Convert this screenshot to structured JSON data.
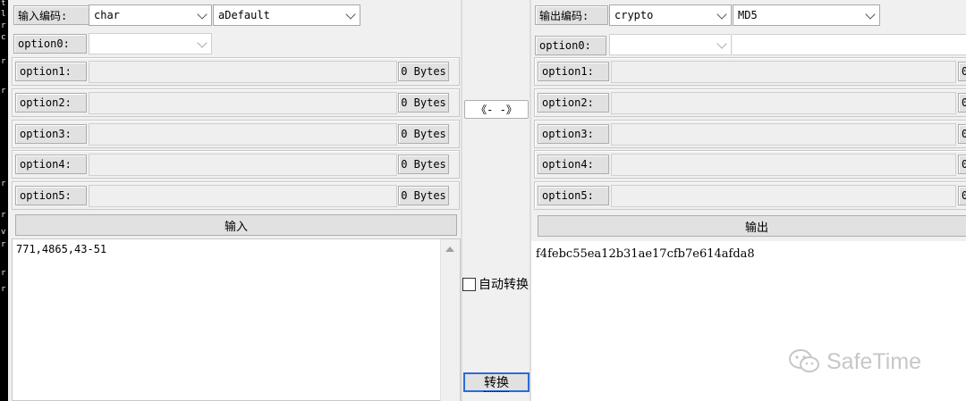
{
  "left_strip_chars": [
    "t",
    "l",
    "r",
    "c",
    "r",
    "r",
    "r",
    "r",
    "v",
    "r",
    "r",
    "r"
  ],
  "input_panel": {
    "encoding_label": "输入编码:",
    "encoding_value": "char",
    "variant_value": "aDefault",
    "option0_label": "option0:",
    "option0_value": "",
    "options": [
      {
        "label": "option1:",
        "size": "0 Bytes"
      },
      {
        "label": "option2:",
        "size": "0 Bytes"
      },
      {
        "label": "option3:",
        "size": "0 Bytes"
      },
      {
        "label": "option4:",
        "size": "0 Bytes"
      },
      {
        "label": "option5:",
        "size": "0 Bytes"
      }
    ],
    "section_button": "输入",
    "text": "771,4865,43-51"
  },
  "middle": {
    "swap_label": "《- -》",
    "auto_convert_label": "自动转换",
    "auto_convert_checked": false,
    "convert_label": "转换"
  },
  "output_panel": {
    "encoding_label": "输出编码:",
    "encoding_value": "crypto",
    "variant_value": "MD5",
    "option0_label": "option0:",
    "option0_value": "",
    "options": [
      {
        "label": "option1:",
        "size": "0"
      },
      {
        "label": "option2:",
        "size": "0"
      },
      {
        "label": "option3:",
        "size": "0"
      },
      {
        "label": "option4:",
        "size": "0"
      },
      {
        "label": "option5:",
        "size": "0"
      }
    ],
    "section_button": "输出",
    "text": "f4febc55ea12b31ae17cfb7e614afda8"
  },
  "watermark": {
    "text": "SafeTime",
    "icon": "wechat-icon"
  }
}
